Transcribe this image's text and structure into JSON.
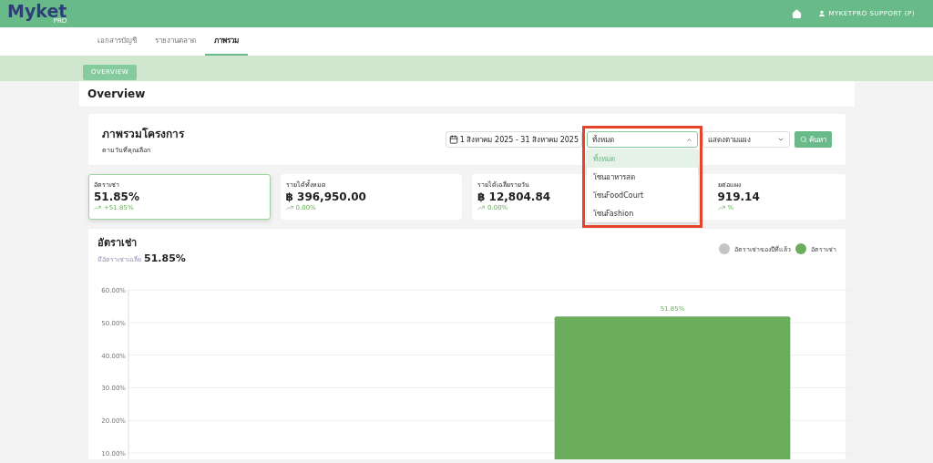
{
  "header": {
    "logo": "Myket",
    "logo_badge": "PRO",
    "user": "MYKETPRO SUPPORT (P)"
  },
  "tabs": [
    {
      "label": "เอกสารบัญชี",
      "selected": false
    },
    {
      "label": "รายงานตลาด",
      "selected": false
    },
    {
      "label": "ภาพรวม",
      "selected": true
    }
  ],
  "subnav_button": "OVERVIEW",
  "page_title": "Overview",
  "filter": {
    "title": "ภาพรวมโครงการ",
    "subtitle": "ตามวันที่คุณเลือก",
    "date_range": "1 สิงหาคม 2025 - 31 สิงหาคม 2025",
    "zone_select": {
      "value": "ทั้งหมด",
      "expanded": true,
      "options": [
        {
          "label": "ทั้งหมด",
          "selected": true
        },
        {
          "label": "โซนอาหารสด",
          "selected": false
        },
        {
          "label": "โซนFoodCourt",
          "selected": false
        },
        {
          "label": "โซนFashion",
          "selected": false
        }
      ]
    },
    "group_select": "แสดงตามแผง",
    "search_button": "ค้นหา"
  },
  "stat_cards": [
    {
      "label": "อัตราเช่า",
      "value": "51.85%",
      "change": "+51.85%",
      "selected": true
    },
    {
      "label": "รายได้ทั้งหมด",
      "value": "฿ 396,950.00",
      "change": "0.00%",
      "selected": false
    },
    {
      "label": "รายได้เฉลี่ยรายวัน",
      "value": "฿ 12,804.84",
      "change": "0.00%",
      "selected": false
    },
    {
      "label": "ยต่อแผง",
      "value": "919.14",
      "change": "%",
      "selected": false
    }
  ],
  "rental_chart": {
    "title": "อัตราเช่า",
    "subtitle": "มีอัตราเช่าเฉลี่ย",
    "average": "51.85%",
    "chart_data": {
      "type": "bar",
      "categories": [
        null
      ],
      "ylim": [
        10,
        60
      ],
      "grid": true,
      "yticks": [
        {
          "value": 10,
          "label": "10.00%"
        },
        {
          "value": 20,
          "label": "20.00%"
        },
        {
          "value": 30,
          "label": "30.00%"
        },
        {
          "value": 40,
          "label": "40.00%"
        },
        {
          "value": 50,
          "label": "50.00%"
        },
        {
          "value": 60,
          "label": "60.00%"
        }
      ],
      "series": [
        {
          "name": "อัตราเช่าของปีที่แล้ว",
          "color": "#c4c4c4",
          "values": [
            null
          ]
        },
        {
          "name": "อัตราเช่า",
          "color": "#69ad5d",
          "values": [
            51.85
          ],
          "value_labels": [
            "51.85%"
          ]
        }
      ]
    }
  }
}
